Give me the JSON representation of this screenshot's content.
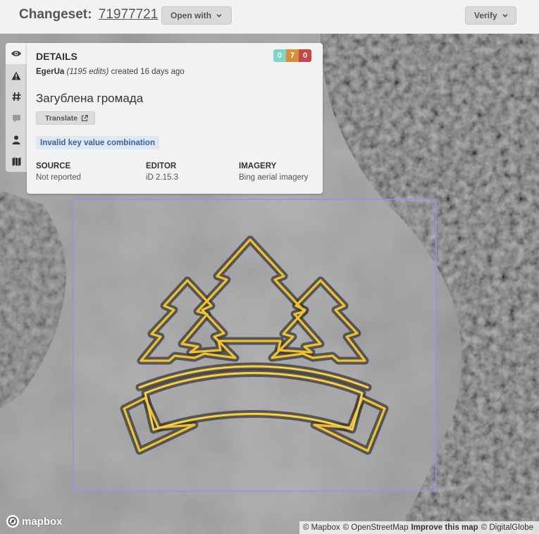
{
  "header": {
    "title_label": "Changeset:",
    "changeset_id": "71977721",
    "open_with_label": "Open with",
    "verify_label": "Verify"
  },
  "sidebar": {
    "tabs": [
      {
        "icon": "eye-icon",
        "active": true
      },
      {
        "icon": "warning-icon"
      },
      {
        "icon": "hash-icon"
      },
      {
        "icon": "comment-icon"
      },
      {
        "icon": "user-icon"
      },
      {
        "icon": "map-icon"
      }
    ]
  },
  "details": {
    "title": "DETAILS",
    "counts": {
      "created": "0",
      "modified": "7",
      "deleted": "0"
    },
    "count_colors": {
      "created": "#7fd3c8",
      "modified": "#d88f3a",
      "deleted": "#c64545"
    },
    "user": "EgerUa",
    "edits": "(1195 edits)",
    "created_text": "created 16 days ago",
    "comment": "Загублена громада",
    "translate_label": "Translate",
    "flag": "Invalid key value combination",
    "source_label": "SOURCE",
    "source_value": "Not reported",
    "editor_label": "EDITOR",
    "editor_value": "iD 2.15.3",
    "imagery_label": "IMAGERY",
    "imagery_value": "Bing aerial imagery"
  },
  "map": {
    "feature_color": "#f0c22e",
    "bbox_color": "#9d8fe0",
    "logo_text": "mapbox",
    "attribution": {
      "mapbox": "© Mapbox",
      "osm": "© OpenStreetMap",
      "improve": "Improve this map",
      "digitalglobe": "© DigitalGlobe"
    }
  }
}
